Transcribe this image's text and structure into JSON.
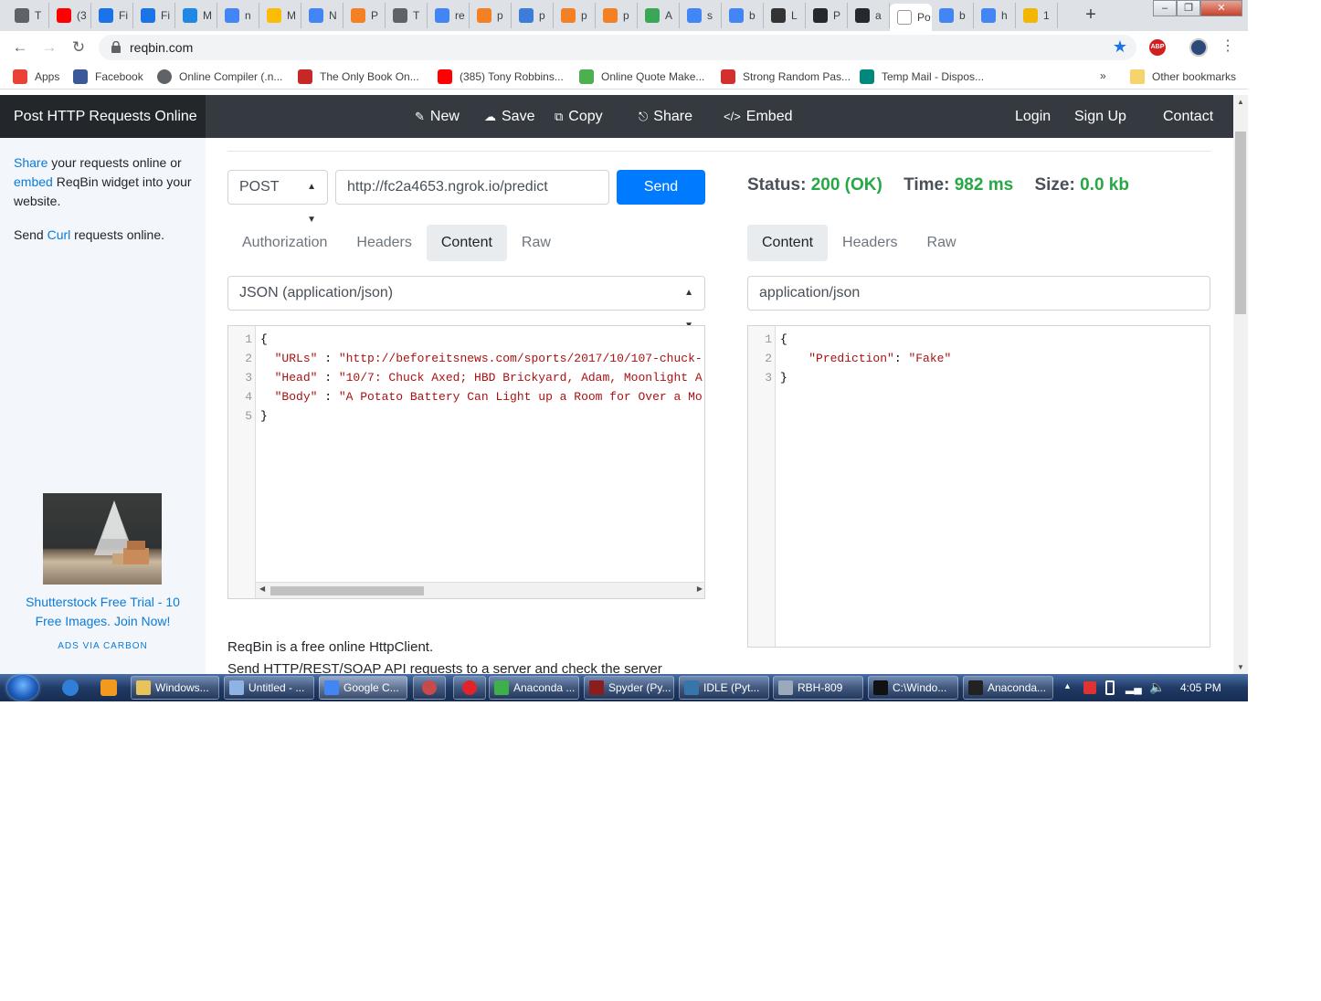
{
  "browser": {
    "tabs": [
      {
        "label": "T",
        "fav": "chrome-icon",
        "color": "#5f6368"
      },
      {
        "label": "(3",
        "fav": "youtube-icon",
        "color": "#ff0000"
      },
      {
        "label": "Fi",
        "fav": "k-icon",
        "color": "#1a73e8"
      },
      {
        "label": "Fi",
        "fav": "k-icon",
        "color": "#1a73e8"
      },
      {
        "label": "M",
        "fav": "s-icon",
        "color": "#1e88e5"
      },
      {
        "label": "n",
        "fav": "google-icon",
        "color": "#4285f4"
      },
      {
        "label": "M",
        "fav": "drive-icon",
        "color": "#fbbc04"
      },
      {
        "label": "N",
        "fav": "google-icon",
        "color": "#4285f4"
      },
      {
        "label": "P",
        "fav": "stackoverflow-icon",
        "color": "#f48024"
      },
      {
        "label": "T",
        "fav": "chrome-icon",
        "color": "#5f6368"
      },
      {
        "label": "re",
        "fav": "google-icon",
        "color": "#4285f4"
      },
      {
        "label": "p",
        "fav": "stackoverflow-icon",
        "color": "#f48024"
      },
      {
        "label": "p",
        "fav": "dash-icon",
        "color": "#3b7dd8"
      },
      {
        "label": "p",
        "fav": "stackoverflow-icon",
        "color": "#f48024"
      },
      {
        "label": "p",
        "fav": "stackoverflow-icon",
        "color": "#f48024"
      },
      {
        "label": "A",
        "fav": "cube-icon",
        "color": "#3aa757"
      },
      {
        "label": "s",
        "fav": "google-icon",
        "color": "#4285f4"
      },
      {
        "label": "b",
        "fav": "google-icon",
        "color": "#4285f4"
      },
      {
        "label": "L",
        "fav": "wikipedia-icon",
        "color": "#333333"
      },
      {
        "label": "P",
        "fav": "github-icon",
        "color": "#24292e"
      },
      {
        "label": "a",
        "fav": "github-icon",
        "color": "#24292e"
      },
      {
        "label": "Po",
        "fav": "reqbin-icon",
        "color": "#ffffff",
        "active": true
      },
      {
        "label": "b",
        "fav": "google-icon",
        "color": "#4285f4"
      },
      {
        "label": "h",
        "fav": "google-icon",
        "color": "#4285f4"
      },
      {
        "label": "1",
        "fav": "emoji-icon",
        "color": "#f2b705"
      }
    ],
    "new_tab": "+",
    "window_buttons": [
      "‒",
      "❐",
      "✕"
    ],
    "url": "reqbin.com",
    "bookmarks": [
      {
        "label": "Apps",
        "icon": "apps-grid-icon",
        "color": "#ea4335"
      },
      {
        "label": "Facebook",
        "icon": "facebook-icon",
        "color": "#3b5998"
      },
      {
        "label": "Online Compiler (.n...",
        "icon": "globe-icon",
        "color": "#5f6368"
      },
      {
        "label": "The Only Book On...",
        "icon": "blp-icon",
        "color": "#c62828"
      },
      {
        "label": "(385) Tony Robbins...",
        "icon": "youtube-icon",
        "color": "#ff0000"
      },
      {
        "label": "Online Quote Make...",
        "icon": "quote-icon",
        "color": "#4caf50"
      },
      {
        "label": "Strong Random Pas...",
        "icon": "p-icon",
        "color": "#d32f2f"
      },
      {
        "label": "Temp Mail - Dispos...",
        "icon": "tempmail-icon",
        "color": "#00897b"
      }
    ],
    "bookmarks_overflow": "»",
    "other_bookmarks": "Other bookmarks"
  },
  "site": {
    "brand": "Post HTTP Requests Online",
    "nav": [
      {
        "label": "New",
        "icon": "edit-icon"
      },
      {
        "label": "Save",
        "icon": "cloud-upload-icon"
      },
      {
        "label": "Copy",
        "icon": "copy-icon"
      },
      {
        "label": "Share",
        "icon": "share-icon"
      },
      {
        "label": "Embed",
        "icon": "code-icon"
      }
    ],
    "auth": {
      "login": "Login",
      "signup": "Sign Up",
      "contact": "Contact"
    },
    "sidebar": {
      "share_link": "Share",
      "share_text": " your requests online or ",
      "embed_link": "embed",
      "embed_text": " ReqBin widget into your website.",
      "send_text": "Send ",
      "curl_link": "Curl",
      "send_text2": " requests online.",
      "ad_text": "Shutterstock Free Trial - 10 Free Images. Join Now!",
      "ads_via": "ADS VIA CARBON"
    }
  },
  "request": {
    "method": "POST",
    "url": "http://fc2a4653.ngrok.io/predict",
    "send_label": "Send",
    "tabs": [
      "Authorization",
      "Headers",
      "Content",
      "Raw"
    ],
    "active_tab": "Content",
    "content_type": "JSON (application/json)",
    "body_lines": [
      {
        "n": "1",
        "text": "{"
      },
      {
        "n": "2",
        "key": "\"URLs\"",
        "sep": " : ",
        "val": "\"http://beforeitsnews.com/sports/2017/10/107-chuck-"
      },
      {
        "n": "3",
        "key": "\"Head\"",
        "sep": " : ",
        "val": "\"10/7: Chuck Axed; HBD Brickyard, Adam, Moonlight A"
      },
      {
        "n": "4",
        "key": "\"Body\"",
        "sep": " : ",
        "val": "\"A Potato Battery Can Light up a Room for Over a Mo"
      },
      {
        "n": "5",
        "text": "}"
      }
    ]
  },
  "response": {
    "status_label": "Status:",
    "status_value": "200 (OK)",
    "time_label": "Time:",
    "time_value": "982 ms",
    "size_label": "Size:",
    "size_value": "0.0 kb",
    "tabs": [
      "Content",
      "Headers",
      "Raw"
    ],
    "active_tab": "Content",
    "content_type": "application/json",
    "body_lines": [
      {
        "n": "1",
        "text": "{"
      },
      {
        "n": "2",
        "key": "\"Prediction\"",
        "sep": ": ",
        "val": "\"Fake\""
      },
      {
        "n": "3",
        "text": "}"
      }
    ],
    "status_color": "#28a745"
  },
  "about": {
    "line1": "ReqBin is a free online HttpClient.",
    "line2": "Send HTTP/REST/SOAP API requests to a server and check the server"
  },
  "taskbar": {
    "tasks": [
      {
        "label": "Windows...",
        "icon": "folder-icon",
        "color": "#e8c25a"
      },
      {
        "label": "Untitled - ...",
        "icon": "notepad-icon",
        "color": "#8fb4e3"
      },
      {
        "label": "Google C...",
        "icon": "chrome-icon",
        "color": "#4285f4",
        "active": true
      },
      {
        "label": "",
        "icon": "app-icon",
        "color": "#c94a4a"
      },
      {
        "label": "",
        "icon": "opera-icon",
        "color": "#e0242a"
      },
      {
        "label": "Anaconda ...",
        "icon": "anaconda-icon",
        "color": "#3eb049"
      },
      {
        "label": "Spyder (Py...",
        "icon": "spyder-icon",
        "color": "#8c1d1d"
      },
      {
        "label": "IDLE (Pyt...",
        "icon": "python-icon",
        "color": "#3776ab"
      },
      {
        "label": "RBH-809",
        "icon": "network-icon",
        "color": "#9aa9bb"
      },
      {
        "label": "C:\\Windo...",
        "icon": "cmd-icon",
        "color": "#111111"
      },
      {
        "label": "Anaconda...",
        "icon": "terminal-icon",
        "color": "#222222"
      }
    ],
    "clock": "4:05 PM"
  }
}
